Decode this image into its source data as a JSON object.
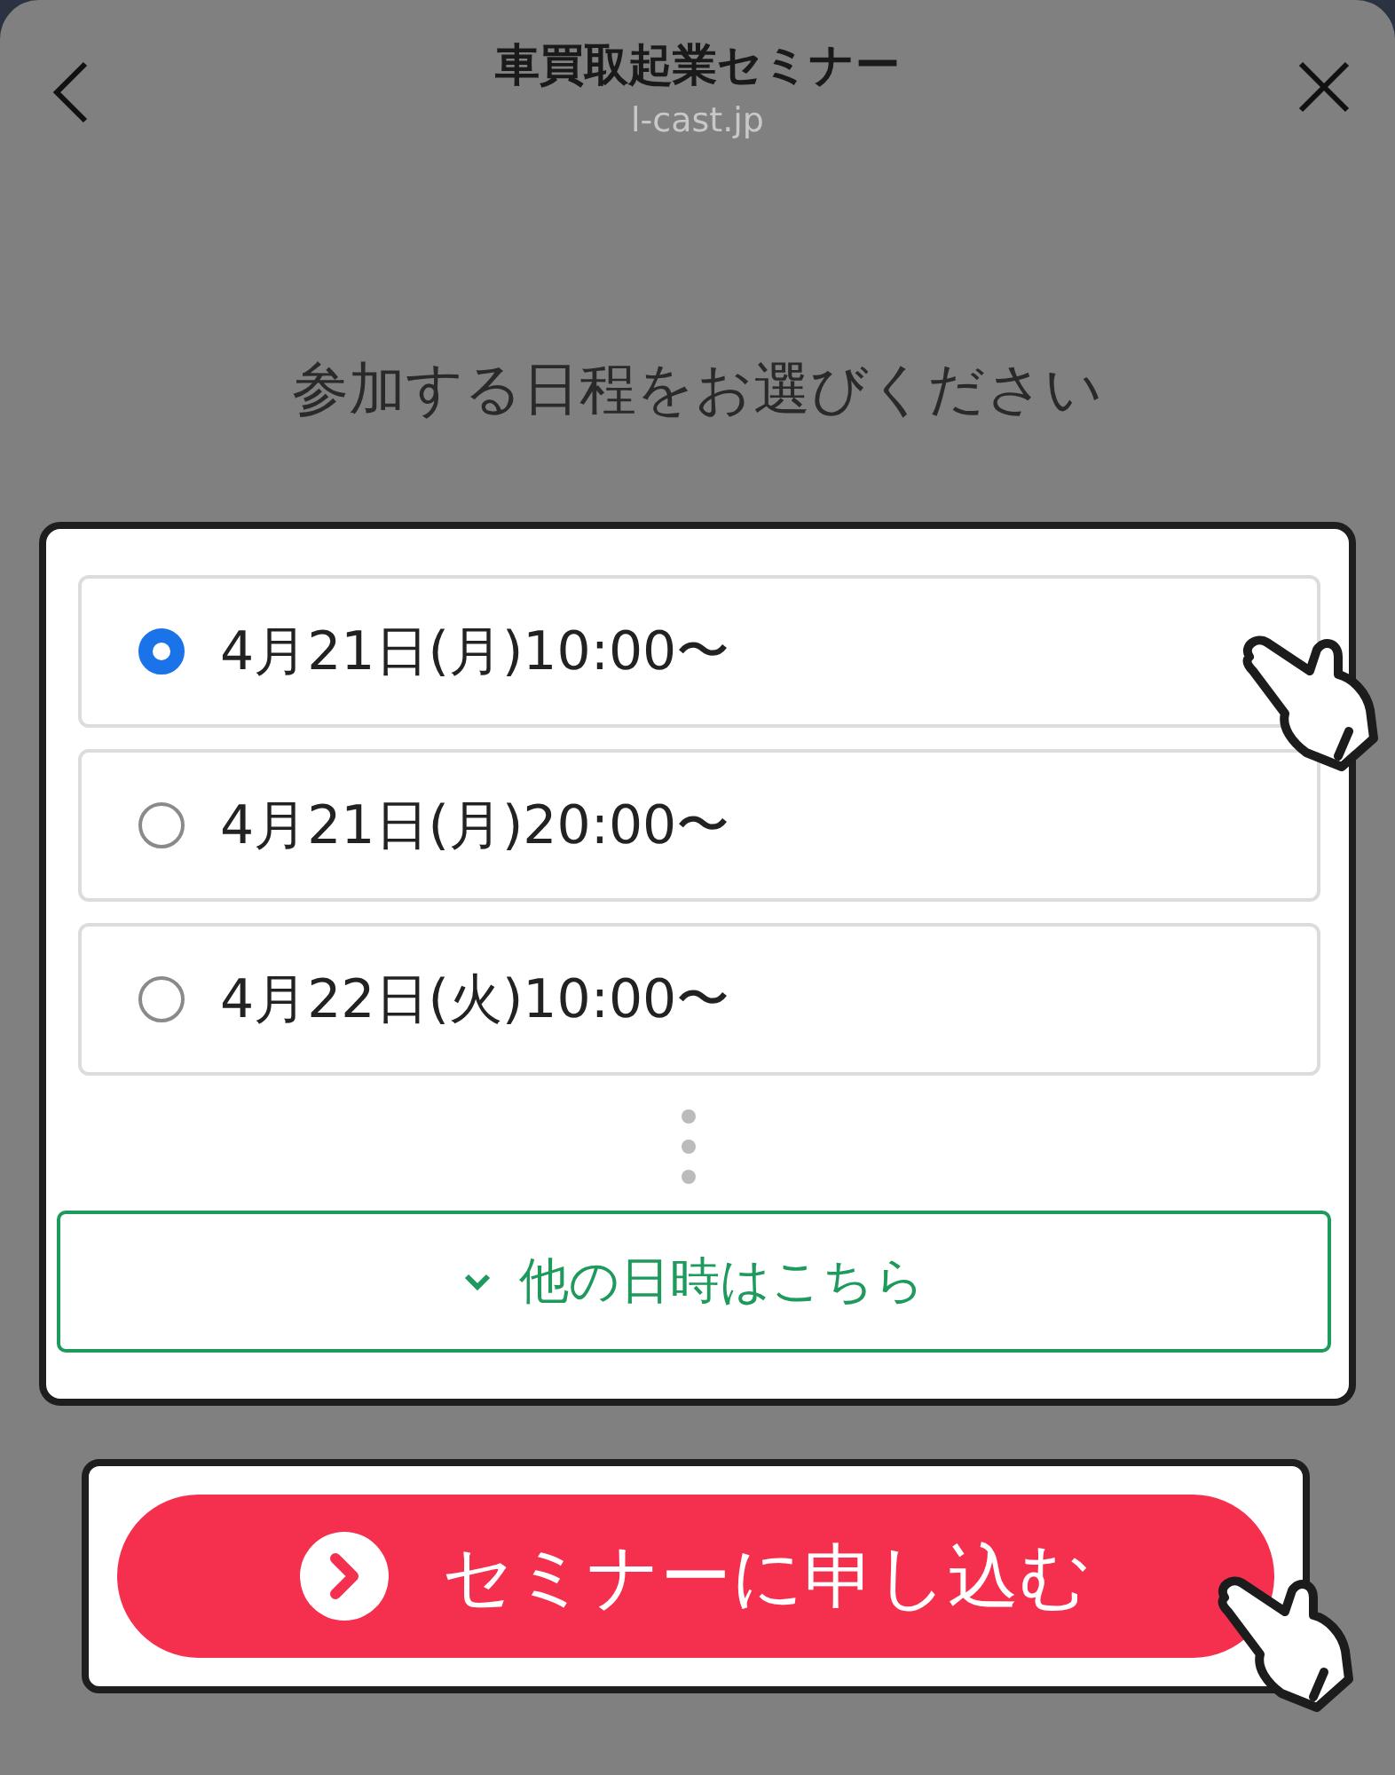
{
  "header": {
    "title": "車買取起業セミナー",
    "domain": "l-cast.jp"
  },
  "prompt": "参加する日程をお選びください",
  "options": [
    {
      "label": "4月21日(月)10:00〜",
      "selected": true
    },
    {
      "label": "4月21日(月)20:00〜",
      "selected": false
    },
    {
      "label": "4月22日(火)10:00〜",
      "selected": false
    }
  ],
  "more_button": {
    "label": "他の日時はこちら"
  },
  "submit_button": {
    "label": "セミナーに申し込む"
  }
}
